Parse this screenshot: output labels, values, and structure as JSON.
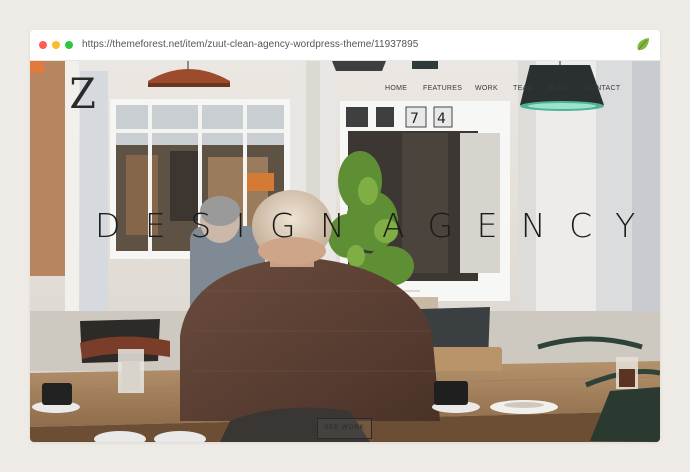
{
  "browser": {
    "url": "https://themeforest.net/item/zuut-clean-agency-wordpress-theme/11937895",
    "brand_icon": "envato-leaf-icon",
    "leaf_color": "#82b541"
  },
  "site": {
    "logo": "Z",
    "nav": [
      "HOME",
      "FEATURES",
      "WORK",
      "TEAM",
      "BLOG",
      "CONTACT"
    ],
    "headline_words": [
      "DESIGN",
      "AGENCY"
    ],
    "cta": "SEE WORK"
  },
  "colors": {
    "page_bg": "#eeebe6",
    "text_dark": "#1c1c1c"
  }
}
